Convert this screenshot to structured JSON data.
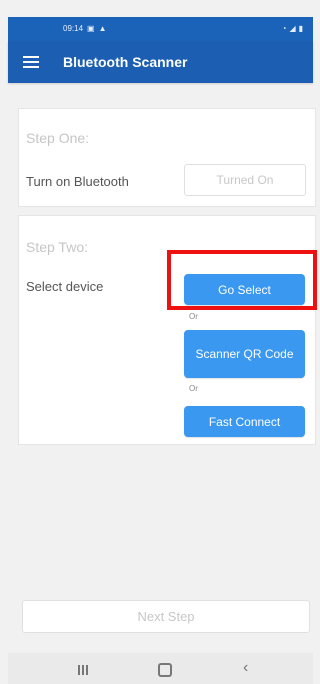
{
  "status_bar": {
    "time": "09:14",
    "left_icons": [
      "image-icon",
      "alert-icon"
    ],
    "right_icons": [
      "wifi-icon",
      "signal-icon",
      "battery-icon"
    ]
  },
  "app_bar": {
    "title": "Bluetooth Scanner",
    "menu_icon": "menu-icon"
  },
  "step_one": {
    "title": "Step One:",
    "label": "Turn on Bluetooth",
    "status_button": "Turned On"
  },
  "step_two": {
    "title": "Step Two:",
    "label": "Select device",
    "buttons": {
      "go_select": "Go Select",
      "scanner_qr": "Scanner QR Code",
      "fast_connect": "Fast Connect"
    },
    "or_labels": [
      "Or",
      "Or"
    ]
  },
  "footer": {
    "next_step": "Next Step"
  },
  "colors": {
    "app_bar": "#1c5fb2",
    "button_primary": "#3a98f0",
    "highlight": "#ee1111",
    "background": "#f1f1f1"
  }
}
